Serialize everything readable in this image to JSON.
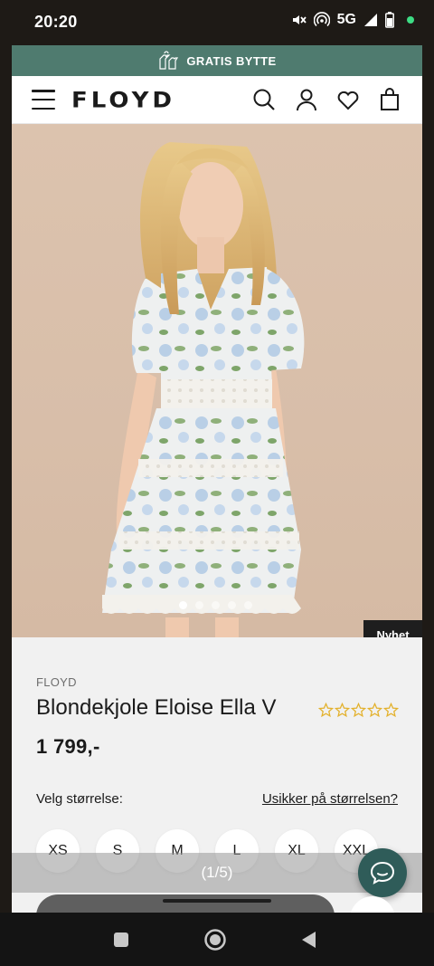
{
  "status": {
    "time": "20:20",
    "network": "5G"
  },
  "promo": {
    "text": "GRATIS BYTTE"
  },
  "header": {
    "logo": "FLOYD"
  },
  "product": {
    "badge": "Nyhet",
    "brand": "FLOYD",
    "title": "Blondekjole Eloise Ella V",
    "rating": 0,
    "rating_max": 5,
    "price": "1 799,-",
    "image_index": 1,
    "image_count": 5,
    "image_counter": "(1/5)"
  },
  "sizes": {
    "label": "Velg størrelse:",
    "help_link": "Usikker på størrelsen?",
    "options": [
      "XS",
      "S",
      "M",
      "L",
      "XL",
      "XXL"
    ]
  },
  "colors": {
    "accent": "#4f7b6f",
    "chat": "#2f5c59",
    "star": "#e3b12c"
  }
}
